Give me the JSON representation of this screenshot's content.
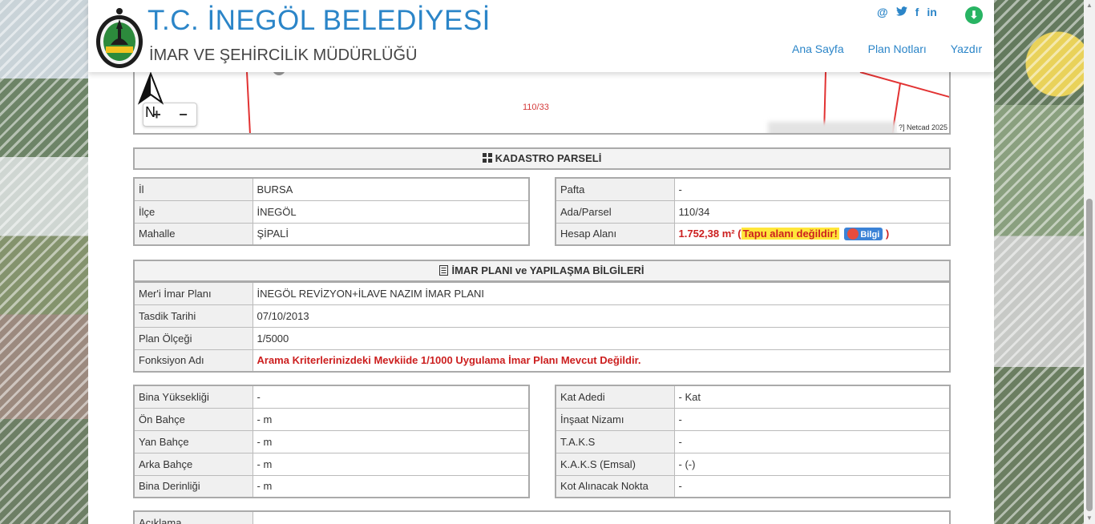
{
  "header": {
    "title": "T.C. İNEGÖL BELEDİYESİ",
    "subtitle": "İMAR VE ŞEHİRCİLİK MÜDÜRLÜĞÜ",
    "social": [
      "@",
      "🐦",
      "f",
      "in"
    ],
    "nav": {
      "home": "Ana Sayfa",
      "plan_notes": "Plan Notları",
      "print": "Yazdır"
    }
  },
  "map": {
    "parcel_label": "110/33",
    "attribution": "?] Netcad 2025",
    "north_label": "N",
    "zoom_in": "+",
    "zoom_out": "−"
  },
  "kadastro": {
    "title": "KADASTRO PARSELİ",
    "left": [
      {
        "label": "İl",
        "value": "BURSA"
      },
      {
        "label": "İlçe",
        "value": "İNEGÖL"
      },
      {
        "label": "Mahalle",
        "value": "ŞİPALİ"
      }
    ],
    "right": {
      "pafta_label": "Pafta",
      "pafta_value": "-",
      "ada_label": "Ada/Parsel",
      "ada_value": "110/34",
      "hesap_label": "Hesap Alanı",
      "hesap_value": "1.752,38 m²",
      "hesap_open": "(",
      "hesap_warning": "Tapu alanı değildir!",
      "hesap_close": ")",
      "bilgi_label": "Bilgi"
    }
  },
  "imar": {
    "title": "İMAR PLANI ve YAPILAŞMA BİLGİLERİ",
    "rows": [
      {
        "label": "Mer'i İmar Planı",
        "value": "İNEGÖL REVİZYON+İLAVE NAZIM İMAR PLANI"
      },
      {
        "label": "Tasdik Tarihi",
        "value": "07/10/2013"
      },
      {
        "label": "Plan Ölçeği",
        "value": "1/5000"
      },
      {
        "label": "Fonksiyon Adı",
        "value": "Arama Kriterlerinizdeki Mevkiide 1/1000 Uygulama İmar Planı Mevcut Değildir."
      }
    ]
  },
  "yapi": {
    "left": [
      {
        "label": "Bina Yüksekliği",
        "value": "-"
      },
      {
        "label": "Ön Bahçe",
        "value": "- m"
      },
      {
        "label": "Yan Bahçe",
        "value": "- m"
      },
      {
        "label": "Arka Bahçe",
        "value": "- m"
      },
      {
        "label": "Bina Derinliği",
        "value": "- m"
      }
    ],
    "right": [
      {
        "label": "Kat Adedi",
        "value": "- Kat"
      },
      {
        "label": "İnşaat Nizamı",
        "value": "-"
      },
      {
        "label": "T.A.K.S",
        "value": "-"
      },
      {
        "label": "K.A.K.S (Emsal)",
        "value": "- (-)"
      },
      {
        "label": "Kot Alınacak Nokta",
        "value": "-"
      }
    ]
  },
  "aciklama": {
    "label": "Açıklama",
    "value": ""
  },
  "colors": {
    "brand_blue": "#2b85c8",
    "warning_red": "#cc1f1f",
    "warning_yellow": "#ffe63a",
    "download_green": "#28b463"
  }
}
